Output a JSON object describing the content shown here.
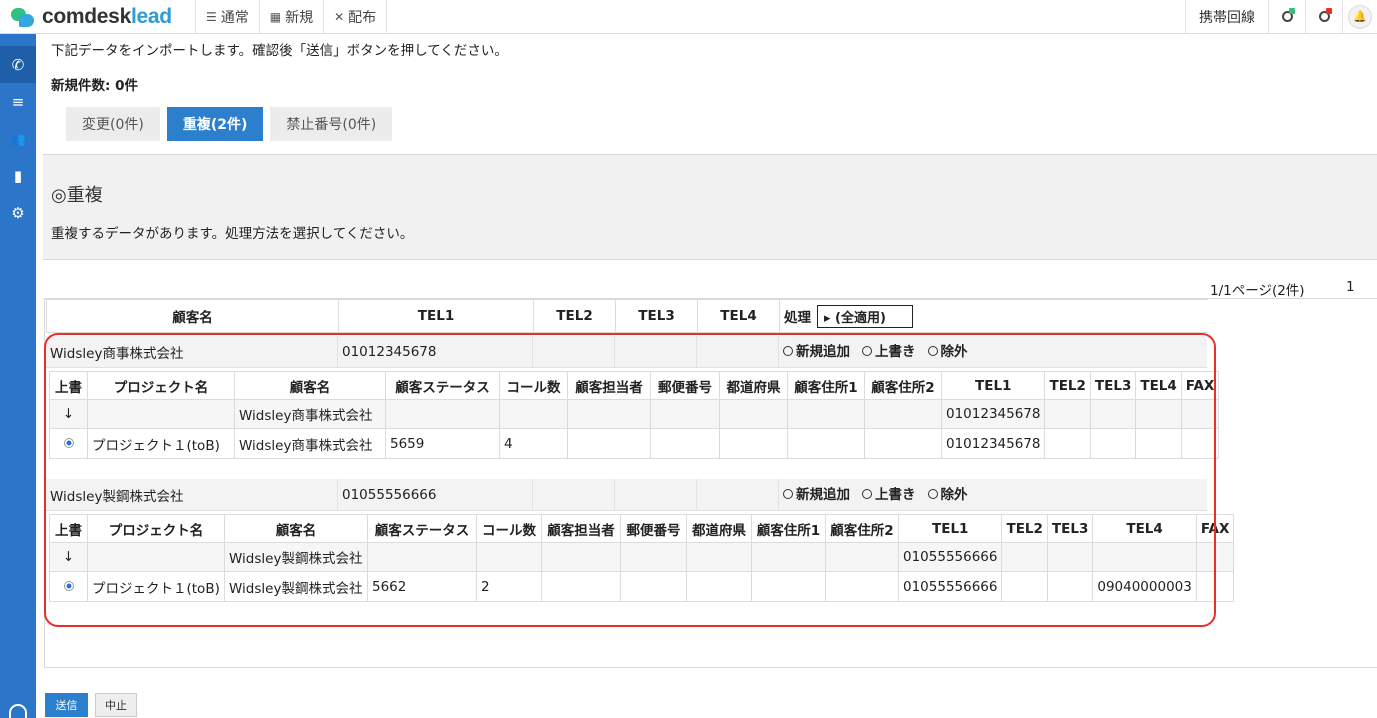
{
  "brand": {
    "part1": "comdesk",
    "part2": "lead"
  },
  "nav": [
    {
      "icon": "list-icon",
      "glyph": "☰",
      "label": "通常"
    },
    {
      "icon": "grid-icon",
      "glyph": "▦",
      "label": "新規"
    },
    {
      "icon": "distribute-icon",
      "glyph": "✕",
      "label": "配布"
    }
  ],
  "topright": {
    "line_label": "携帯回線",
    "bell": "🔔"
  },
  "sidebar": [
    {
      "icon": "phone-icon",
      "glyph": "✆"
    },
    {
      "icon": "database-icon",
      "glyph": "≡"
    },
    {
      "icon": "users-icon",
      "glyph": "👥"
    },
    {
      "icon": "chart-icon",
      "glyph": "▮"
    },
    {
      "icon": "gear-icon",
      "glyph": "⚙"
    }
  ],
  "page": {
    "intro": "下記データをインポートします。確認後「送信」ボタンを押してください。",
    "new_count": "新規件数: 0件",
    "tabs": [
      "変更(0件)",
      "重複(2件)",
      "禁止番号(0件)"
    ],
    "section_title": "◎重複",
    "section_desc": "重複するデータがあります。処理方法を選択してください。",
    "pager": "1/1ページ(2件)",
    "page_num": "1"
  },
  "header": {
    "cols": [
      "顧客名",
      "TEL1",
      "TEL2",
      "TEL3",
      "TEL4"
    ],
    "process_label": "処理",
    "apply_all": "▸ (全適用)"
  },
  "options": [
    "新規追加",
    "上書き",
    "除外"
  ],
  "groups": [
    {
      "name": "Widsley商事株式会社",
      "tel1": "01012345678",
      "sub_headers": [
        "上書",
        "プロジェクト名",
        "顧客名",
        "顧客ステータス",
        "コール数",
        "顧客担当者",
        "郵便番号",
        "都道府県",
        "顧客住所1",
        "顧客住所2",
        "TEL1",
        "TEL2",
        "TEL3",
        "TEL4",
        "FAX"
      ],
      "arrow_row": [
        "↓",
        "",
        "Widsley商事株式会社",
        "",
        "",
        "",
        "",
        "",
        "",
        "",
        "01012345678",
        "",
        "",
        "",
        ""
      ],
      "data_row": [
        "",
        "プロジェクト１(toB)",
        "Widsley商事株式会社",
        "5659",
        "4",
        "",
        "",
        "",
        "",
        "",
        "01012345678",
        "",
        "",
        "",
        ""
      ]
    },
    {
      "name": "Widsley製鋼株式会社",
      "tel1": "01055556666",
      "sub_headers": [
        "上書",
        "プロジェクト名",
        "顧客名",
        "顧客ステータス",
        "コール数",
        "顧客担当者",
        "郵便番号",
        "都道府県",
        "顧客住所1",
        "顧客住所2",
        "TEL1",
        "TEL2",
        "TEL3",
        "TEL4",
        "FAX"
      ],
      "arrow_row": [
        "↓",
        "",
        "Widsley製鋼株式会社",
        "",
        "",
        "",
        "",
        "",
        "",
        "",
        "01055556666",
        "",
        "",
        "",
        ""
      ],
      "data_row": [
        "",
        "プロジェクト１(toB)",
        "Widsley製鋼株式会社",
        "5662",
        "2",
        "",
        "",
        "",
        "",
        "",
        "01055556666",
        "",
        "",
        "09040000003",
        ""
      ]
    }
  ],
  "buttons": {
    "send": "送信",
    "stop": "中止"
  }
}
